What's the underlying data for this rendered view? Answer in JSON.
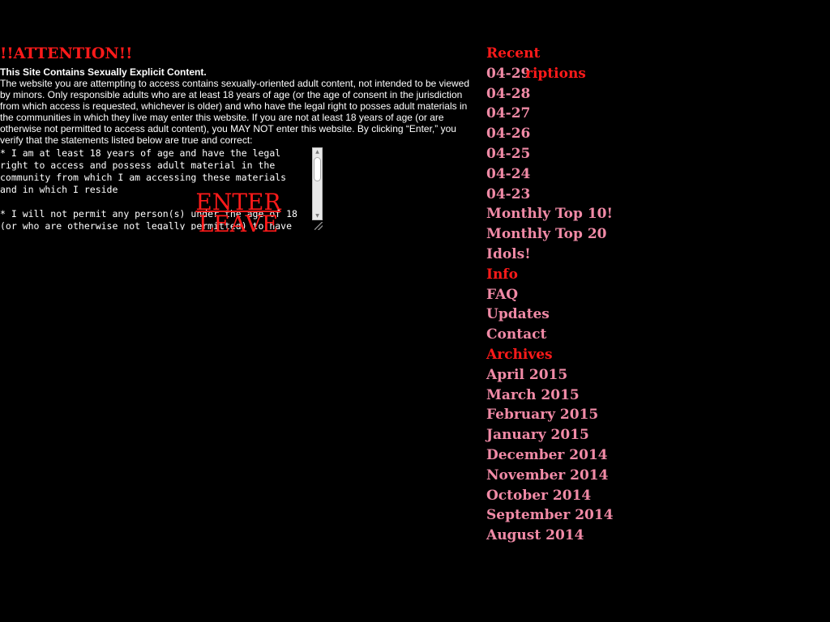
{
  "notice": {
    "attention": "!!ATTENTION!!",
    "title": "This Site Contains Sexually Explicit Content.",
    "body": "The website you are attempting to access contains sexually-oriented adult content, not intended to be viewed by minors. Only responsible adults who are at least 18 years of age (or the age of consent in the jurisdiction from which access is requested, whichever is older) and who have the legal right to posses adult materials in the communities in which they live may enter this website. If you are not at least 18 years of age (or are otherwise not permitted to access adult content), you MAY NOT enter this website. By clicking “Enter,” you verify that the statements listed below are true and correct:",
    "terms": "* I am at least 18 years of age and have the legal\nright to access and possess adult material in the\ncommunity from which I am accessing these materials\nand in which I reside\n\n* I will not permit any person(s) under the age of 18\n(or who are otherwise not legally permitted) to have",
    "enter_label": "ENTER",
    "leave_label": "LEAVE"
  },
  "sidebar": {
    "recent_heading": "Recent",
    "recent_items": [
      "04-29",
      "04-28",
      "04-27",
      "04-26",
      "04-25",
      "04-24",
      "04-23",
      "Monthly Top 10!",
      "Monthly Top 20 Idols!"
    ],
    "overlap_text": "riptions",
    "info_heading": "Info",
    "info_items": [
      "FAQ",
      "Updates",
      "Contact"
    ],
    "archives_heading": "Archives",
    "archive_items": [
      "April 2015",
      "March 2015",
      "February 2015",
      "January 2015",
      "December 2014",
      "November 2014",
      "October 2014",
      "September 2014",
      "August 2014"
    ]
  },
  "colors": {
    "background": "#000000",
    "heading_red": "#ff1a1a",
    "link_pink": "#f08aa6",
    "text_white": "#ffffff"
  }
}
